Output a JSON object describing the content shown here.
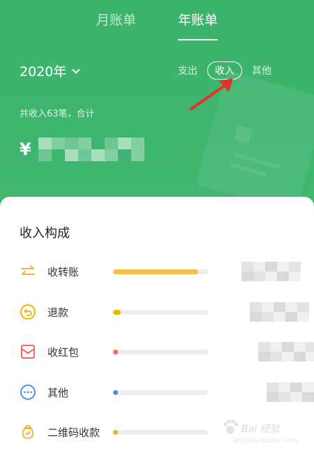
{
  "tabs": [
    {
      "label": "月账单",
      "active": false
    },
    {
      "label": "年账单",
      "active": true
    }
  ],
  "year_selector": {
    "label": "2020年"
  },
  "filters": [
    {
      "label": "支出",
      "selected": false
    },
    {
      "label": "收入",
      "selected": true
    },
    {
      "label": "其他",
      "selected": false
    }
  ],
  "summary": {
    "text": "共收入63笔，合计",
    "currency": "¥"
  },
  "breakdown": {
    "title": "收入构成",
    "items": [
      {
        "label": "收转账",
        "fraction": 0.9,
        "color": "#f5c04a",
        "icon": "transfer-arrows-icon"
      },
      {
        "label": "退款",
        "fraction": 0.08,
        "color": "#f1b400",
        "icon": "refund-icon"
      },
      {
        "label": "收红包",
        "fraction": 0.03,
        "color": "#ef6a5a",
        "icon": "red-envelope-icon"
      },
      {
        "label": "其他",
        "fraction": 0.03,
        "color": "#4a90e2",
        "icon": "more-dots-icon"
      },
      {
        "label": "二维码收款",
        "fraction": 0.03,
        "color": "#e8b03a",
        "icon": "money-bag-icon"
      }
    ]
  },
  "watermark": {
    "text": "Bai 经验",
    "sub": "jingyan.baidu.com"
  }
}
